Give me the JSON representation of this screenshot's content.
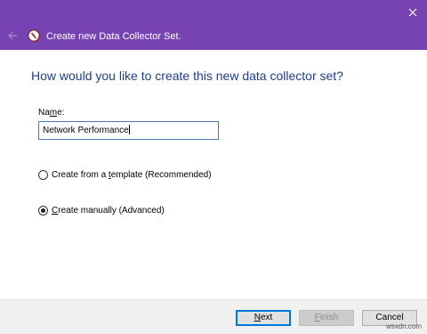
{
  "window": {
    "title": "Create new Data Collector Set.",
    "colors": {
      "titlebar": "#7743b3",
      "heading": "#1e3e8c",
      "focus": "#0078d7"
    }
  },
  "main": {
    "heading": "How would you like to create this new data collector set?",
    "name_label": {
      "before": "Na",
      "accel": "m",
      "after": "e:"
    },
    "name_value": "Network Performance",
    "options": [
      {
        "before": "Create from a ",
        "accel": "t",
        "after": "emplate (Recommended)",
        "selected": false
      },
      {
        "before": "",
        "accel": "C",
        "after": "reate manually (Advanced)",
        "selected": true
      }
    ]
  },
  "footer": {
    "buttons": [
      {
        "accel": "N",
        "rest": "ext",
        "enabled": true,
        "default": true
      },
      {
        "accel": "F",
        "rest": "inish",
        "enabled": false,
        "default": false
      },
      {
        "accel": "",
        "rest": "Cancel",
        "enabled": true,
        "default": false
      }
    ]
  },
  "watermark": "wsxdn.com",
  "icons": [
    "close-icon",
    "back-arrow-icon",
    "data-collector-app-icon"
  ]
}
